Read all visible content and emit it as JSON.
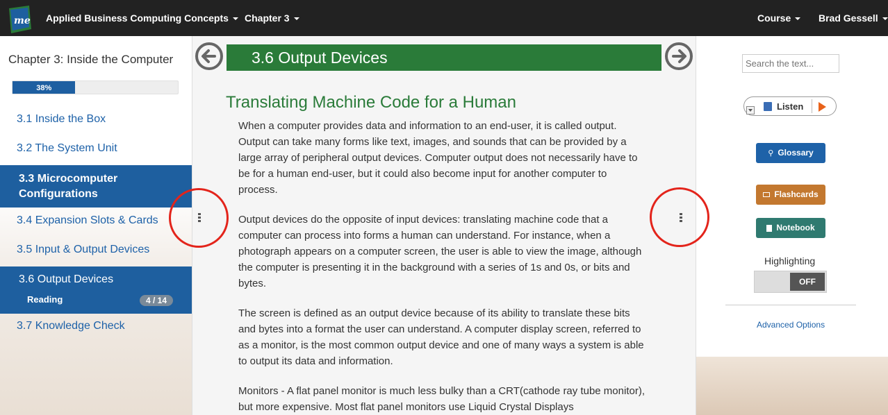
{
  "topbar": {
    "logo_text": "me",
    "course_title": "Applied Business Computing Concepts",
    "chapter_menu": "Chapter 3",
    "course_menu": "Course",
    "user_menu": "Brad Gessell"
  },
  "sidebar": {
    "chapter_title": "Chapter 3: Inside the Computer",
    "progress_label": "38%",
    "progress_value": 0.38,
    "items": [
      {
        "label": "3.1 Inside the Box"
      },
      {
        "label": "3.2 The System Unit"
      },
      {
        "label": "3.3 Microcomputer Configurations"
      },
      {
        "label": "3.4 Expansion Slots & Cards"
      },
      {
        "label": "3.5 Input & Output Devices"
      },
      {
        "label": "3.6 Output Devices",
        "sub_label": "Reading",
        "badge": "4 / 14"
      },
      {
        "label": "3.7 Knowledge Check"
      }
    ]
  },
  "content": {
    "section_title": "3.6  Output Devices",
    "subheading": "Translating Machine Code for a Human",
    "paragraphs": [
      "When a computer provides data and information to an end-user, it is called output. Output can take many forms like text, images, and sounds that can be provided by a large array of peripheral output devices. Computer output does not necessarily have to be for a human end-user, but it could also become input for another computer to process.",
      "Output devices do the opposite of input devices: translating machine code that a computer can process into forms a human can understand. For instance, when a photograph appears on a computer screen, the user is able to view the image, although the computer is presenting it in the background with a series of 1s and 0s, or bits and bytes.",
      "The screen is defined as an output device because of its ability to translate these bits and bytes into a format the user can understand. A computer display screen, referred to as a monitor, is the most common output device and one of many ways a system is able to output its data and information.",
      "Monitors - A flat panel monitor is much less bulky than a CRT(cathode ray tube monitor), but more expensive. Most flat panel monitors use Liquid Crystal Displays"
    ]
  },
  "tools": {
    "search_placeholder": "Search the text...",
    "listen_label": "Listen",
    "glossary_label": "Glossary",
    "flashcards_label": "Flashcards",
    "notebook_label": "Notebook",
    "highlighting_label": "Highlighting",
    "highlighting_state": "OFF",
    "advanced_label": "Advanced Options"
  },
  "colors": {
    "topbar": "#222222",
    "accent_blue": "#1e5f9f",
    "section_green": "#2a7b39",
    "glossary": "#1e62a8",
    "flashcards": "#c3782f",
    "notebook": "#2f7a70",
    "annotation_red": "#e3241b"
  }
}
